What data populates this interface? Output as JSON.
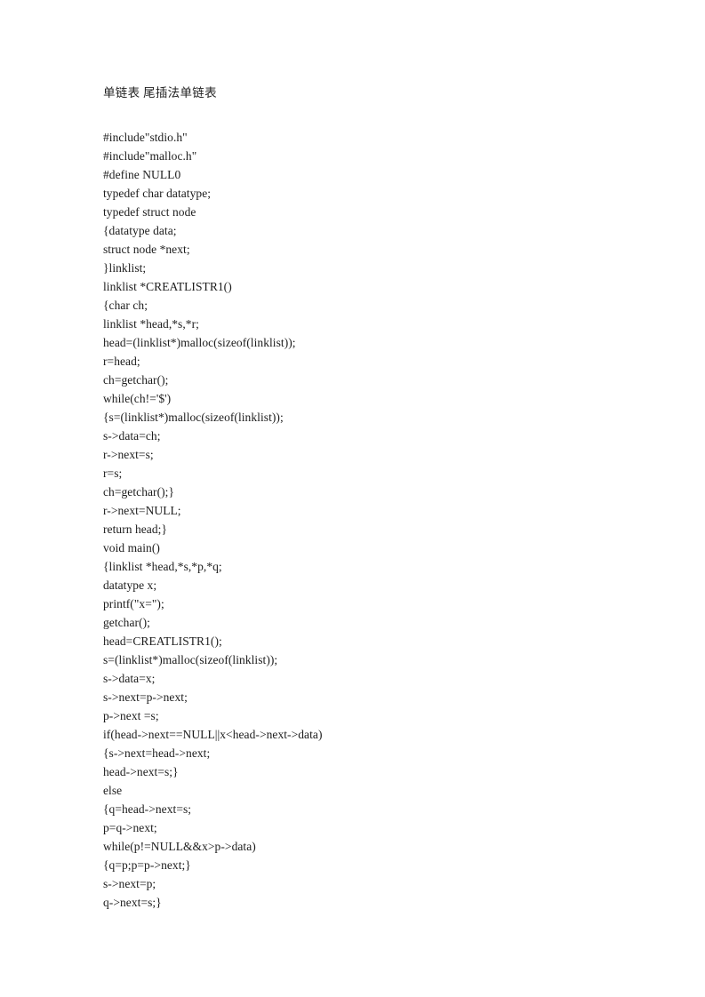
{
  "document": {
    "title": "单链表 尾插法单链表",
    "background_color": "#ffffff",
    "text_color": "#1c1c1c",
    "page_size": "793x1122"
  },
  "code": {
    "language": "C",
    "lines": [
      "#include\"stdio.h\"",
      "#include\"malloc.h\"",
      "#define NULL0",
      "typedef char datatype;",
      "typedef struct node",
      "{datatype data;",
      "struct node *next;",
      "}linklist;",
      "linklist *CREATLISTR1()",
      "{char ch;",
      "linklist *head,*s,*r;",
      "head=(linklist*)malloc(sizeof(linklist));",
      "r=head;",
      "ch=getchar();",
      "while(ch!='$')",
      "{s=(linklist*)malloc(sizeof(linklist));",
      "s->data=ch;",
      "r->next=s;",
      "r=s;",
      "ch=getchar();}",
      "r->next=NULL;",
      "return head;}",
      "void main()",
      "{linklist *head,*s,*p,*q;",
      "datatype x;",
      "printf(\"x=\");",
      "getchar();",
      "head=CREATLISTR1();",
      "s=(linklist*)malloc(sizeof(linklist));",
      "s->data=x;",
      "s->next=p->next;",
      "p->next =s;",
      "if(head->next==NULL||x<head->next->data)",
      "{s->next=head->next;",
      "head->next=s;}",
      "else",
      "{q=head->next=s;",
      "p=q->next;",
      "while(p!=NULL&&x>p->data)",
      "{q=p;p=p->next;}",
      "s->next=p;",
      "q->next=s;}"
    ]
  }
}
